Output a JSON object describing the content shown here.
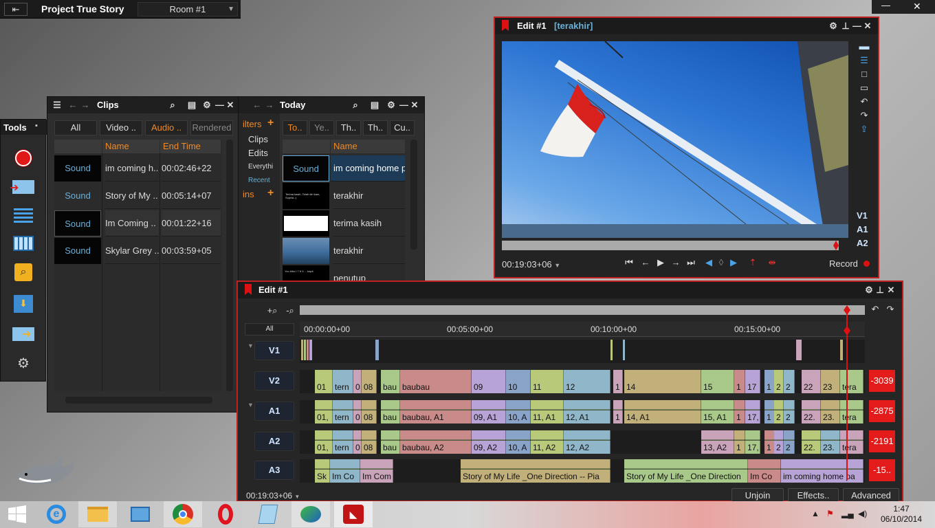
{
  "topbar": {
    "project_title": "Project True Story",
    "room": "Room #1"
  },
  "tools": {
    "title": "Tools"
  },
  "clips_panel": {
    "title": "Clips",
    "tabs": [
      "All",
      "Video ..",
      "Audio ..",
      "Rendered"
    ],
    "col_name": "Name",
    "col_end": "End Time",
    "rows": [
      {
        "type": "Sound",
        "name": "im coming h..",
        "end": "00:02:46+22"
      },
      {
        "type": "Sound",
        "name": "Story of My ..",
        "end": "00:05:14+07"
      },
      {
        "type": "Sound",
        "name": "Im Coming ..",
        "end": "00:01:22+16"
      },
      {
        "type": "Sound",
        "name": "Skylar Grey ..",
        "end": "00:03:59+05"
      }
    ]
  },
  "today_panel": {
    "title": "Today",
    "filters_label": "ilters",
    "filters": [
      "Clips",
      "Edits",
      "Everythi",
      "Recent"
    ],
    "bins_label": "ins",
    "tabs": [
      "To..",
      "Ye..",
      "Th..",
      "Th..",
      "Cu.."
    ],
    "col_name": "Name",
    "rows": [
      {
        "type": "Sound",
        "name": "im coming home p"
      },
      {
        "type": "thumb-text",
        "name": "terakhir",
        "thumb_text": "Terima kasih, Telah diri kam, Suprisi-:)"
      },
      {
        "type": "thumb-white",
        "name": "terima kasih"
      },
      {
        "type": "thumb-sea",
        "name": "terakhir"
      },
      {
        "type": "thumb-text2",
        "name": "penutup",
        "thumb_text": "Yoo bitio t 7 8 9 ... bapit"
      }
    ]
  },
  "viewer": {
    "title": "Edit #1",
    "subtitle": "[terakhir]",
    "timecode": "00:19:03+06",
    "record_label": "Record",
    "tracks": [
      "V1",
      "A1",
      "A2"
    ]
  },
  "timeline": {
    "title": "Edit #1",
    "all_label": "All",
    "ruler": [
      "00:00:00+00",
      "00:05:00+00",
      "00:10:00+00",
      "00:15:00+00"
    ],
    "tracks": [
      "V1",
      "V2",
      "A1",
      "A2",
      "A3"
    ],
    "counters": [
      "-3039",
      "-2875",
      "-2191",
      "-15.."
    ],
    "timecode": "00:19:03+06",
    "buttons": [
      "Unjoin",
      "Effects..",
      "Advanced"
    ],
    "v2_labels": [
      "01",
      "tern",
      "0",
      "08",
      "bau",
      "baubau",
      "09",
      "10",
      "11",
      "12",
      "1",
      "14",
      "15",
      "1",
      "17",
      "1",
      "2",
      "2",
      "22",
      "23",
      "tera"
    ],
    "a1_labels": [
      "01,",
      "tern",
      "0",
      "08",
      "bau",
      "baubau, A1",
      "09, A1",
      "10, A",
      "11, A1",
      "12, A1",
      "1",
      "14, A1",
      "15, A1",
      "1",
      "17,",
      "1",
      "2",
      "2",
      "22.",
      "23.",
      "tera"
    ],
    "a2_labels": [
      "01,",
      "tern",
      "0",
      "08",
      "bau",
      "baubau, A2",
      "09, A2",
      "10, A",
      "11, A2",
      "12, A2",
      "13, A2",
      "1",
      "17,",
      "1",
      "2",
      "2",
      "22.",
      "23.",
      "tera"
    ],
    "a3_labels": [
      "Sk",
      "Im Co",
      "Im Com",
      "Story of My Life _One Direction -- Pia",
      "Story of My Life _One Direction",
      "Im Co",
      "im coming home pa"
    ]
  },
  "taskbar": {
    "time": "1:47",
    "date": "06/10/2014"
  }
}
